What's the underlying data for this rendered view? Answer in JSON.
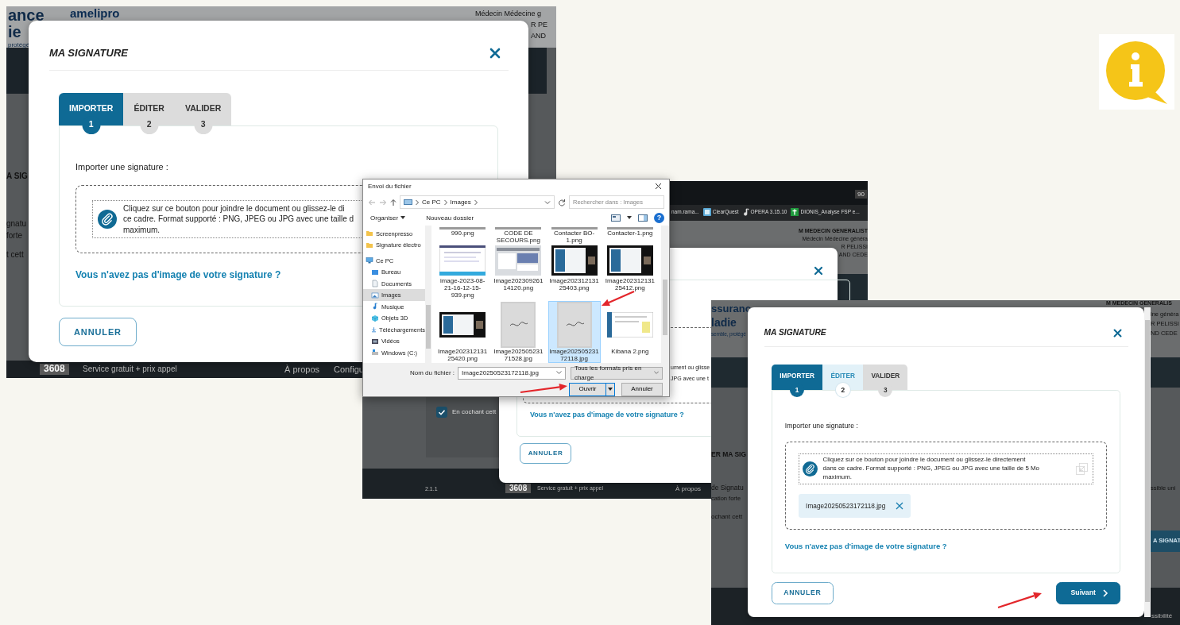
{
  "screens": [
    {
      "page_texts": [
        "ance",
        "ie",
        "protégé",
        "amelipro",
        "Médecin Médecine g",
        "R PE",
        "AND",
        "A SIG",
        "gnatu",
        "forte",
        "t cett"
      ],
      "footer": {
        "number": "3608",
        "tagline": "Service gratuit + prix appel",
        "links": [
          "À propos",
          "Configu"
        ]
      },
      "modal": {
        "title": "MA SIGNATURE",
        "tabs": [
          {
            "label": "IMPORTER",
            "number": "1",
            "selected": true,
            "enabled": true
          },
          {
            "label": "ÉDITER",
            "number": "2",
            "selected": false,
            "enabled": false
          },
          {
            "label": "VALIDER",
            "number": "3",
            "selected": false,
            "enabled": false
          }
        ],
        "prompt": "Importer une signature :",
        "dropzone_text": "Cliquez sur ce bouton pour joindre le document ou glissez-le di\nce cadre. Format supporté : PNG, JPEG ou JPG avec une taille d\nmaximum.",
        "link": "Vous n'avez pas d'image de votre signature ?",
        "buttons": [
          {
            "label": "ANNULER",
            "kind": "secondary"
          }
        ]
      }
    },
    {
      "browser": {
        "badge": "90",
        "bookmarks": [
          {
            "label": "nam.rama...",
            "kind": "plain"
          },
          {
            "label": "ClearQuest",
            "kind": "app"
          },
          {
            "label": "OPERA 3.15.10",
            "kind": "note"
          },
          {
            "label": "DIONIS_Analyse FSP e...",
            "kind": "cross"
          }
        ]
      },
      "page_texts": [
        "M MEDECIN GENERALIST",
        "Médecin Médecine généra",
        "R PELISSI",
        "AND CEDE"
      ],
      "checkbox": {
        "label": "En cochant cett",
        "checked": true
      },
      "modal": {
        "texts": [
          "ument ou glisse",
          "JPG avec une t"
        ],
        "link": "Vous n'avez pas d'image de votre signature ?",
        "buttons": [
          {
            "label": "ANNULER",
            "kind": "secondary"
          }
        ]
      },
      "footer": {
        "version": "2.1.1",
        "number": "3608",
        "tagline": "Service gratuit + prix appel",
        "links": [
          "À propos"
        ]
      }
    },
    {
      "page_texts": [
        "ssuranc",
        "ladie",
        "semble, protégé",
        "M MEDECIN GENERALIS",
        "ine généra",
        "R PELISSI",
        "ND CEDE",
        "ER MA SIG",
        "de Signatu",
        "cation forte",
        "ochant cett",
        "ssible uni",
        "A SIGNAT",
        "ssibilité"
      ],
      "modal": {
        "title": "MA SIGNATURE",
        "tabs": [
          {
            "label": "IMPORTER",
            "number": "1",
            "selected": true,
            "enabled": true
          },
          {
            "label": "ÉDITER",
            "number": "2",
            "selected": false,
            "enabled": true
          },
          {
            "label": "VALIDER",
            "number": "3",
            "selected": false,
            "enabled": false
          }
        ],
        "prompt": "Importer une signature :",
        "dropzone_text": "Cliquez sur ce bouton pour joindre le document ou glissez-le directement\ndans ce cadre. Format supporté : PNG, JPEG ou JPG avec une taille de 5 Mo\nmaximum.",
        "file": {
          "name": "Image20250523172118.jpg"
        },
        "link": "Vous n'avez pas d'image de votre signature ?",
        "buttons": [
          {
            "label": "ANNULER",
            "kind": "secondary"
          },
          {
            "label": "Suivant",
            "kind": "primary"
          }
        ]
      }
    }
  ],
  "file_dialog": {
    "title": "Envoi du fichier",
    "path": [
      "Ce PC",
      "Images"
    ],
    "search_placeholder": "Rechercher dans : Images",
    "toolbar": [
      "Organiser",
      "Nouveau dossier"
    ],
    "help": "?",
    "nav": [
      {
        "label": "Screenpresso",
        "kind": "folder",
        "selected": false
      },
      {
        "label": "Signature électro",
        "kind": "folder",
        "selected": false
      },
      {
        "label": "Ce PC",
        "kind": "pc",
        "selected": false,
        "children": [
          {
            "label": "Bureau",
            "kind": "desktop",
            "selected": false
          },
          {
            "label": "Documents",
            "kind": "docs",
            "selected": false
          },
          {
            "label": "Images",
            "kind": "pictures",
            "selected": true
          },
          {
            "label": "Musique",
            "kind": "music",
            "selected": false
          },
          {
            "label": "Objets 3D",
            "kind": "cube",
            "selected": false
          },
          {
            "label": "Téléchargements",
            "kind": "download",
            "selected": false
          },
          {
            "label": "Vidéos",
            "kind": "video",
            "selected": false
          },
          {
            "label": "Windows (C:)",
            "kind": "drive",
            "selected": false
          }
        ]
      }
    ],
    "files": [
      {
        "name": "990.png",
        "kind": "cut",
        "selected": false
      },
      {
        "name": "CODE DE SECOURS.png",
        "kind": "cut",
        "selected": false
      },
      {
        "name": "Contacter BO-1.png",
        "kind": "cut",
        "selected": false
      },
      {
        "name": "Contacter-1.png",
        "kind": "cut",
        "selected": false
      },
      {
        "name": "image-2023-08-21-16-12-15-939.png",
        "kind": "page",
        "selected": false
      },
      {
        "name": "Image20230926114120.png",
        "kind": "app",
        "selected": false
      },
      {
        "name": "Image20231213125403.png",
        "kind": "call",
        "selected": false
      },
      {
        "name": "Image20231213125412.png",
        "kind": "call",
        "selected": false
      },
      {
        "name": "Image20231213125420.png",
        "kind": "call",
        "selected": false
      },
      {
        "name": "Image20250523171528.jpg",
        "kind": "paper",
        "selected": false
      },
      {
        "name": "Image20250523172118.jpg",
        "kind": "paper",
        "selected": true
      },
      {
        "name": "Kibana 2.png",
        "kind": "sheet",
        "selected": false
      }
    ],
    "filename_label": "Nom du fichier :",
    "filename": "Image20250523172118.jpg",
    "filter": "Tous les formats pris en charge",
    "buttons": [
      {
        "label": "Ouvrir",
        "kind": "primary"
      },
      {
        "label": "Annuler",
        "kind": "secondary"
      }
    ]
  }
}
